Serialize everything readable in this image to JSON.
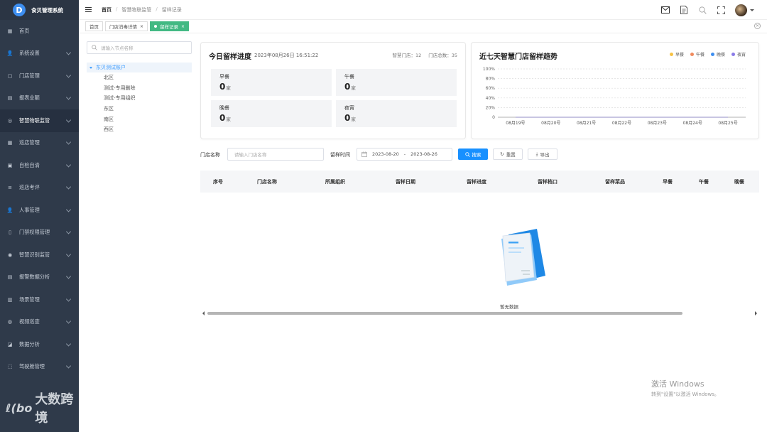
{
  "app": {
    "title": "食贝管理系统",
    "logo_letter": "D"
  },
  "sidebar": {
    "items": [
      {
        "label": "首页",
        "icon": "dashboard-icon",
        "glyph": "▦",
        "expandable": false,
        "active": false
      },
      {
        "label": "系统设置",
        "icon": "user-icon",
        "glyph": "👤",
        "expandable": true,
        "active": false
      },
      {
        "label": "门店管理",
        "icon": "store-icon",
        "glyph": "▢",
        "expandable": true,
        "active": false
      },
      {
        "label": "报表业额",
        "icon": "report-icon",
        "glyph": "▤",
        "expandable": true,
        "active": false
      },
      {
        "label": "智慧物联监管",
        "icon": "iot-icon",
        "glyph": "◎",
        "expandable": true,
        "active": true
      },
      {
        "label": "巡店管理",
        "icon": "grid-icon",
        "glyph": "▦",
        "expandable": true,
        "active": false
      },
      {
        "label": "自检自清",
        "icon": "checklist-icon",
        "glyph": "▣",
        "expandable": true,
        "active": false
      },
      {
        "label": "巡店考评",
        "icon": "evaluate-icon",
        "glyph": "≡",
        "expandable": true,
        "active": false
      },
      {
        "label": "人事管理",
        "icon": "person-icon",
        "glyph": "👤",
        "expandable": true,
        "active": false
      },
      {
        "label": "门禁权限管理",
        "icon": "door-icon",
        "glyph": "▯",
        "expandable": true,
        "active": false
      },
      {
        "label": "智慧识别监管",
        "icon": "recognize-icon",
        "glyph": "◉",
        "expandable": true,
        "active": false
      },
      {
        "label": "报警数据分析",
        "icon": "alarm-icon",
        "glyph": "▤",
        "expandable": true,
        "active": false
      },
      {
        "label": "场景管理",
        "icon": "scene-icon",
        "glyph": "▥",
        "expandable": true,
        "active": false
      },
      {
        "label": "视频巡查",
        "icon": "video-icon",
        "glyph": "◍",
        "expandable": true,
        "active": false
      },
      {
        "label": "数据分析",
        "icon": "analysis-icon",
        "glyph": "◪",
        "expandable": true,
        "active": false
      },
      {
        "label": "驾驶舱管理",
        "icon": "cockpit-icon",
        "glyph": "⬚",
        "expandable": true,
        "active": false
      }
    ],
    "watermark": {
      "mark": "ℓ(bo",
      "text": "大数跨境"
    }
  },
  "header": {
    "breadcrumb": [
      "首页",
      "智慧物联监管",
      "留样记录"
    ],
    "icons": [
      "mail-icon",
      "document-icon",
      "search-icon",
      "fullscreen-icon",
      "avatar"
    ]
  },
  "tabs": [
    {
      "label": "首页",
      "closable": false,
      "active": false
    },
    {
      "label": "门店消毒详情",
      "closable": true,
      "active": false
    },
    {
      "label": "留样记录",
      "closable": true,
      "active": true
    }
  ],
  "tree": {
    "search_placeholder": "请输入节点名称",
    "root": "东贝测试账户",
    "children": [
      "北区",
      "测试-专用删除",
      "测试-专用组织",
      "东区",
      "南区",
      "西区"
    ]
  },
  "today_card": {
    "title": "今日留样进度",
    "datetime": "2023年08月26日 16:51:22",
    "smart_store_label": "智慧门店：",
    "smart_store_value": "12",
    "total_store_label": "门店总数：",
    "total_store_value": "35",
    "stats": [
      {
        "label": "早餐",
        "value": "0",
        "unit": "家"
      },
      {
        "label": "午餐",
        "value": "0",
        "unit": "家"
      },
      {
        "label": "晚餐",
        "value": "0",
        "unit": "家"
      },
      {
        "label": "夜宵",
        "value": "0",
        "unit": "家"
      }
    ]
  },
  "trend_card": {
    "title": "近七天智慧门店留样趋势"
  },
  "chart_data": {
    "type": "line",
    "title": "近七天智慧门店留样趋势",
    "categories": [
      "08月19号",
      "08月20号",
      "08月21号",
      "08月22号",
      "08月23号",
      "08月24号",
      "08月25号"
    ],
    "yticks": [
      "0",
      "20%",
      "40%",
      "60%",
      "80%",
      "100%"
    ],
    "ylim": [
      0,
      100
    ],
    "grid": true,
    "legend_position": "top-right",
    "series": [
      {
        "name": "早餐",
        "color": "#f7c244",
        "values": [
          0,
          0,
          0,
          0,
          0,
          0,
          0
        ]
      },
      {
        "name": "午餐",
        "color": "#f08a5d",
        "values": [
          0,
          0,
          0,
          0,
          0,
          0,
          0
        ]
      },
      {
        "name": "晚餐",
        "color": "#3d8ef0",
        "values": [
          0,
          0,
          0,
          0,
          0,
          0,
          0
        ]
      },
      {
        "name": "夜宵",
        "color": "#8a7be8",
        "values": [
          0,
          0,
          0,
          0,
          0,
          0,
          0
        ]
      }
    ]
  },
  "filter": {
    "store_label": "门店名称",
    "store_placeholder": "请输入门店名称",
    "time_label": "留样时间",
    "date_start": "2023-08-20",
    "date_sep": "-",
    "date_end": "2023-08-26",
    "search_label": "搜索",
    "reset_label": "重置",
    "export_label": "导出"
  },
  "table": {
    "columns": [
      "序号",
      "门店名称",
      "所属组织",
      "留样日期",
      "留样进度",
      "留样档口",
      "留样菜品",
      "早餐",
      "午餐",
      "晚餐"
    ],
    "empty_text": "暂无数据"
  },
  "os_watermark": {
    "line1": "激活 Windows",
    "line2": "转到\"设置\"以激活 Windows。"
  },
  "colors": {
    "sidebar_bg": "#2f3a4a",
    "primary": "#1890ff",
    "active_tab": "#42b983",
    "tree_highlight": "#409eff"
  }
}
